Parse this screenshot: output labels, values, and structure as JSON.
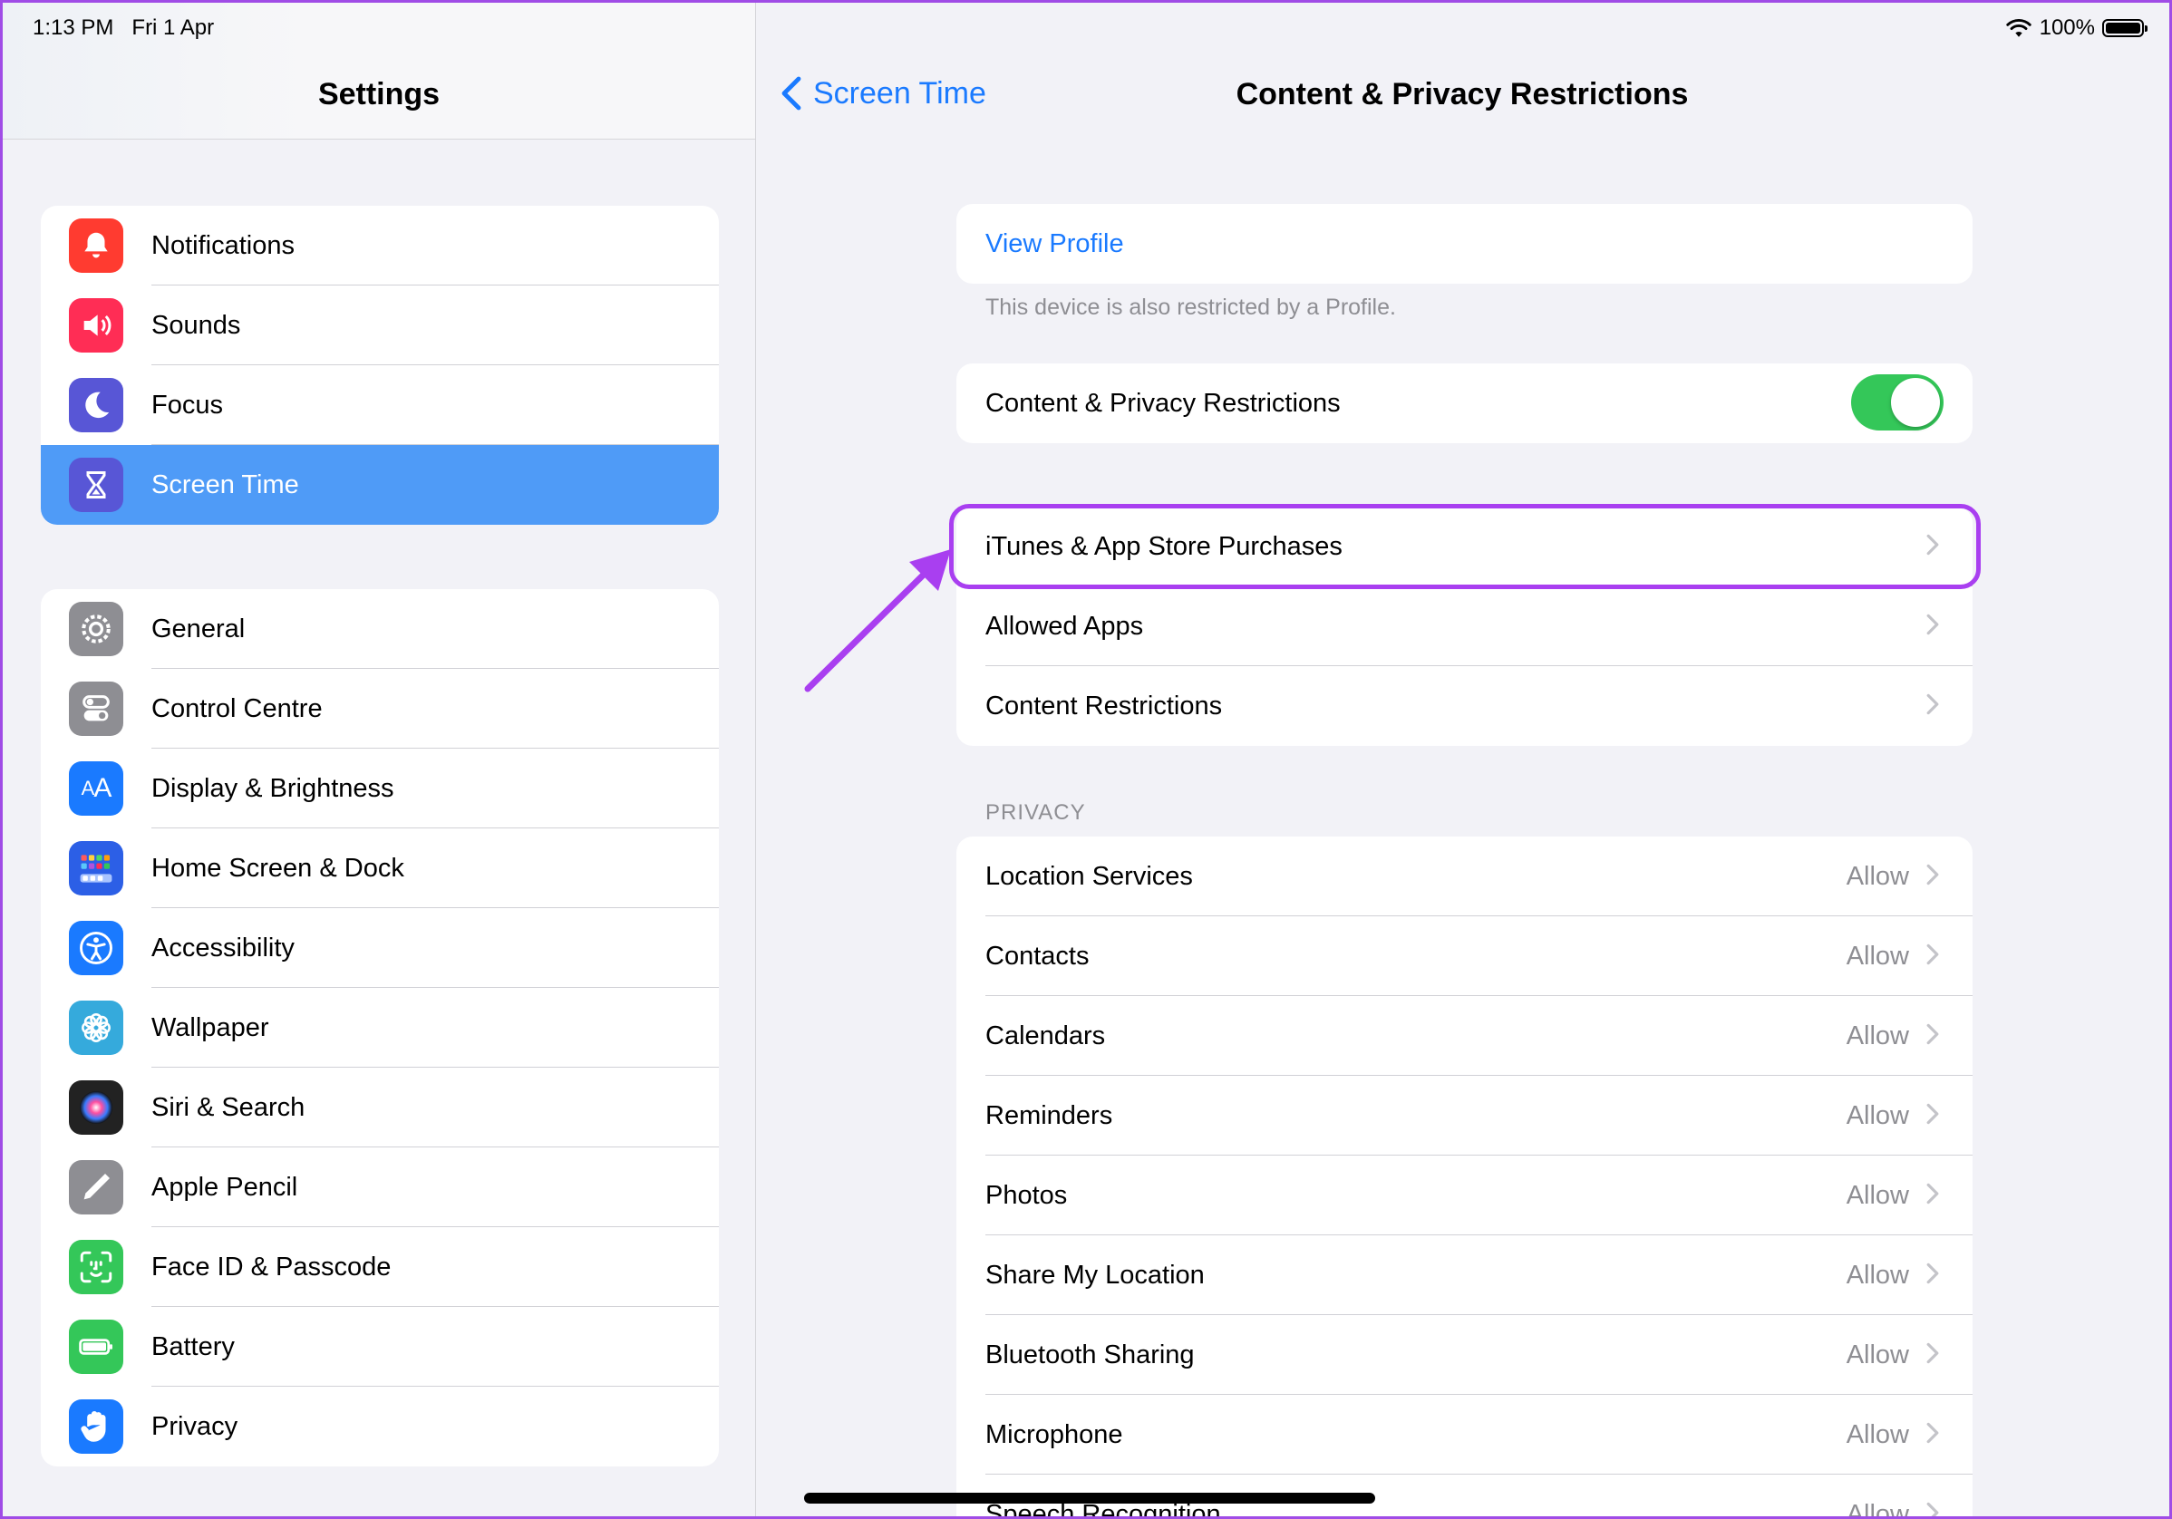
{
  "status_bar": {
    "time": "1:13 PM",
    "date": "Fri 1 Apr",
    "battery": "100%",
    "battery_level": 1.0
  },
  "sidebar": {
    "title": "Settings",
    "groups": [
      {
        "items": [
          {
            "label": "Notifications",
            "icon": "bell-icon",
            "color": "#ff3b30"
          },
          {
            "label": "Sounds",
            "icon": "speaker-icon",
            "color": "#ff2d55"
          },
          {
            "label": "Focus",
            "icon": "moon-icon",
            "color": "#5856d6"
          },
          {
            "label": "Screen Time",
            "icon": "hourglass-icon",
            "color": "#5856d6",
            "selected": true
          }
        ]
      },
      {
        "items": [
          {
            "label": "General",
            "icon": "gear-icon",
            "color": "#8e8e93"
          },
          {
            "label": "Control Centre",
            "icon": "switches-icon",
            "color": "#8e8e93"
          },
          {
            "label": "Display & Brightness",
            "icon": "text-size-icon",
            "color": "#1a7aff"
          },
          {
            "label": "Home Screen & Dock",
            "icon": "app-grid-icon",
            "color": "#2c5fe6"
          },
          {
            "label": "Accessibility",
            "icon": "accessibility-icon",
            "color": "#1a7aff"
          },
          {
            "label": "Wallpaper",
            "icon": "flower-icon",
            "color": "#35aadc"
          },
          {
            "label": "Siri & Search",
            "icon": "siri-icon",
            "color": "#222222"
          },
          {
            "label": "Apple Pencil",
            "icon": "pencil-icon",
            "color": "#8e8e93"
          },
          {
            "label": "Face ID & Passcode",
            "icon": "face-id-icon",
            "color": "#34c759"
          },
          {
            "label": "Battery",
            "icon": "battery-icon",
            "color": "#34c759"
          },
          {
            "label": "Privacy",
            "icon": "hand-icon",
            "color": "#1a7aff"
          }
        ]
      }
    ]
  },
  "detail": {
    "back_label": "Screen Time",
    "title": "Content & Privacy Restrictions",
    "profile": {
      "link": "View Profile",
      "footer": "This device is also restricted by a Profile."
    },
    "master_toggle": {
      "label": "Content & Privacy Restrictions",
      "on": true
    },
    "store_group": [
      {
        "label": "iTunes & App Store Purchases",
        "highlighted": true
      },
      {
        "label": "Allowed Apps"
      },
      {
        "label": "Content Restrictions"
      }
    ],
    "privacy_header": "PRIVACY",
    "privacy_items": [
      {
        "label": "Location Services",
        "value": "Allow"
      },
      {
        "label": "Contacts",
        "value": "Allow"
      },
      {
        "label": "Calendars",
        "value": "Allow"
      },
      {
        "label": "Reminders",
        "value": "Allow"
      },
      {
        "label": "Photos",
        "value": "Allow"
      },
      {
        "label": "Share My Location",
        "value": "Allow"
      },
      {
        "label": "Bluetooth Sharing",
        "value": "Allow"
      },
      {
        "label": "Microphone",
        "value": "Allow"
      },
      {
        "label": "Speech Recognition",
        "value": "Allow"
      }
    ]
  },
  "colors": {
    "accent": "#1a7aff",
    "annotation": "#a93ff0",
    "toggle_on": "#34c759",
    "selected_row": "#4f9bf7"
  }
}
